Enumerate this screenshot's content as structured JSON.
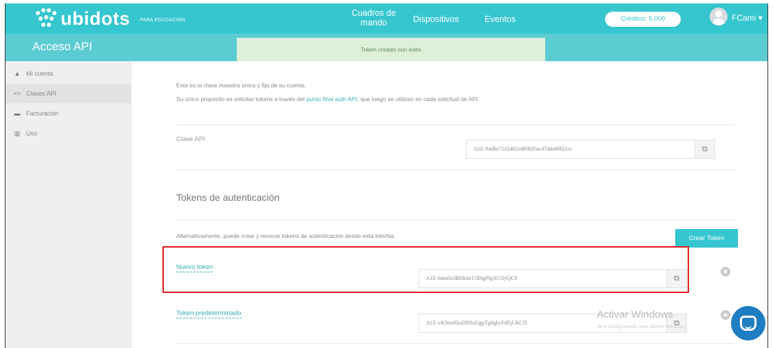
{
  "header": {
    "brand": "ubidots",
    "brand_sub": "PARA EDUCACIÓN",
    "nav": [
      "Cuadros de mando",
      "Dispositivos",
      "Eventos"
    ],
    "credits": "Créditos: 5.000",
    "user": "FCami ▾"
  },
  "subbar": {
    "title": "Acceso API",
    "toast": "Token creado con éxito"
  },
  "sidebar": {
    "items": [
      {
        "icon": "user-icon",
        "glyph": "▲",
        "label": "Mi cuenta"
      },
      {
        "icon": "code-icon",
        "glyph": "<>",
        "label": "Claves API"
      },
      {
        "icon": "card-icon",
        "glyph": "▬",
        "label": "Facturación"
      },
      {
        "icon": "chart-icon",
        "glyph": "▥",
        "label": "Uso"
      }
    ]
  },
  "main": {
    "intro1": "Esta es la clave maestra única y fija de su cuenta.",
    "intro2_pre": "Su único propósito es solicitar tokens a través del ",
    "intro2_link": "punto final auth API",
    "intro2_post": ", que luego se utilizan en cada solicitud de API.",
    "api_key_label": "Clave API",
    "api_key_value": "A1E-94dbe7102482ed69fd5ac47d4a9f821cc",
    "tokens_title": "Tokens de autenticación",
    "tokens_desc": "Alternativamente, puede crear y revocar tokens de autenticación desde esta interfaz.",
    "create_button": "Crear Token",
    "tokens": [
      {
        "name": "Nuevo token",
        "value": "A1E-bma0u3Bfib4n15lf0gPlg3G5fyQC0"
      },
      {
        "name": "Token predeterminado",
        "value": "A1E-vK0mr92oDDSsUgpTg0gbcFdFjURCD"
      }
    ]
  },
  "watermark": {
    "title": "Activar Windows",
    "sub": "Ve a Configuración para activar Windows."
  },
  "colors": {
    "accent": "#35c6cf",
    "toast_bg": "#dff0d8",
    "highlight": "#e01b1b",
    "chat": "#1f7dc1"
  }
}
